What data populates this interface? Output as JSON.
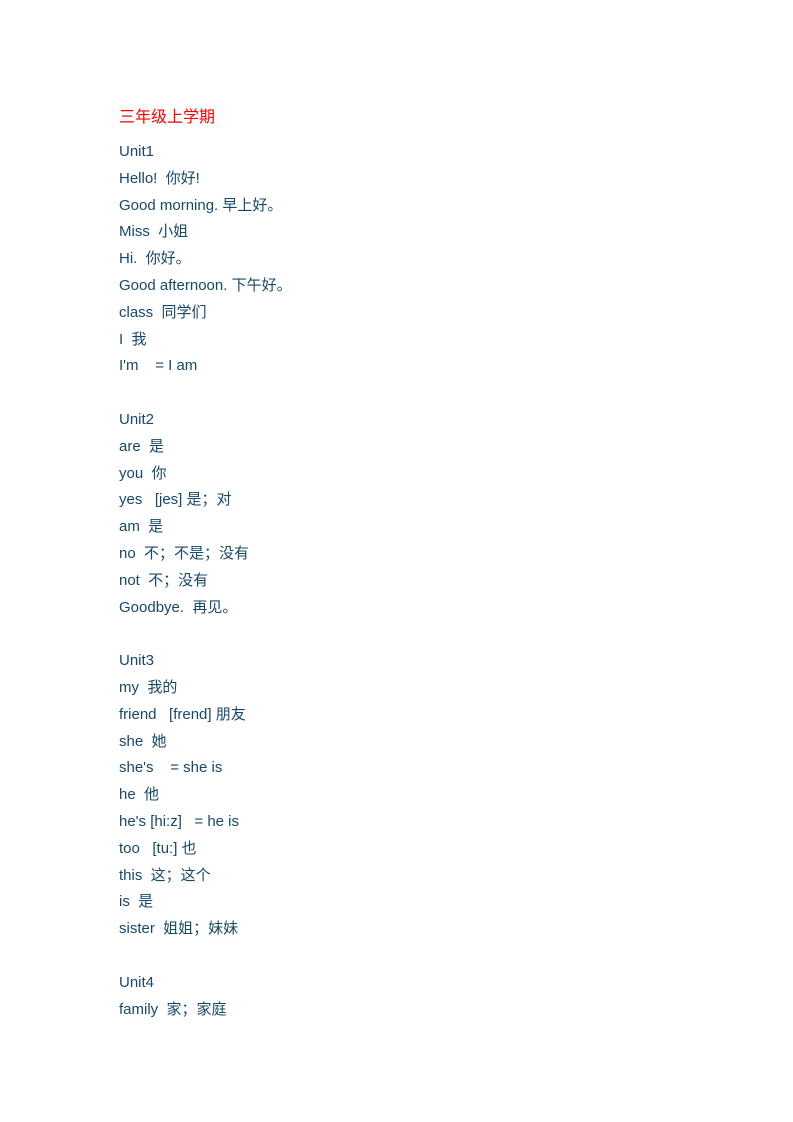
{
  "document": {
    "title": "三年级上学期",
    "blocks": [
      {
        "heading": "Unit1",
        "entries": [
          "Hello!  你好!",
          "Good morning. 早上好。",
          "Miss  小姐",
          "Hi.  你好。",
          "Good afternoon. 下午好。",
          "class  同学们",
          "I  我",
          "I'm    = I am"
        ]
      },
      {
        "heading": "Unit2",
        "entries": [
          "are  是",
          "you  你",
          "yes   [jes] 是；对",
          "am  是",
          "no  不；不是；没有",
          "not  不；没有",
          "Goodbye.  再见。"
        ]
      },
      {
        "heading": "Unit3",
        "entries": [
          "my  我的",
          "friend   [frend] 朋友",
          "she  她",
          "she's    = she is",
          "he  他",
          "he's [hi:z]   = he is",
          "too   [tu:] 也",
          "this  这；这个",
          "is  是",
          "sister  姐姐；妹妹"
        ]
      },
      {
        "heading": "Unit4",
        "entries": [
          "family  家；家庭"
        ]
      }
    ]
  }
}
